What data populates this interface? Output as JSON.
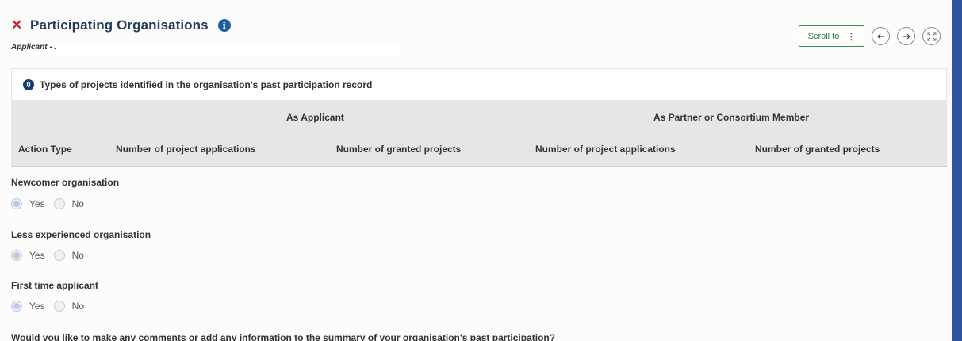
{
  "header": {
    "title": "Participating Organisations",
    "subtitle": "Applicant - ."
  },
  "toolbar": {
    "scroll_label": "Scroll to"
  },
  "past_participation": {
    "count": "0",
    "heading": "Types of projects identified in the organisation's past participation record",
    "group_applicant": "As Applicant",
    "group_partner": "As Partner or Consortium Member",
    "columns": [
      "Action Type",
      "Number of project applications",
      "Number of granted projects",
      "Number of project applications",
      "Number of granted projects"
    ]
  },
  "fields": [
    {
      "label": "Newcomer organisation",
      "options": [
        "Yes",
        "No"
      ],
      "selected": "Yes"
    },
    {
      "label": "Less experienced organisation",
      "options": [
        "Yes",
        "No"
      ],
      "selected": "Yes"
    },
    {
      "label": "First time applicant",
      "options": [
        "Yes",
        "No"
      ],
      "selected": "Yes"
    }
  ],
  "comment_question": "Would you like to make any comments or add any information to the summary of your organisation's past participation?",
  "colors": {
    "accent": "#30549e",
    "close": "#cc1f2f",
    "scroll_button": "#3b8f4e",
    "badge": "#1b3d6d"
  }
}
